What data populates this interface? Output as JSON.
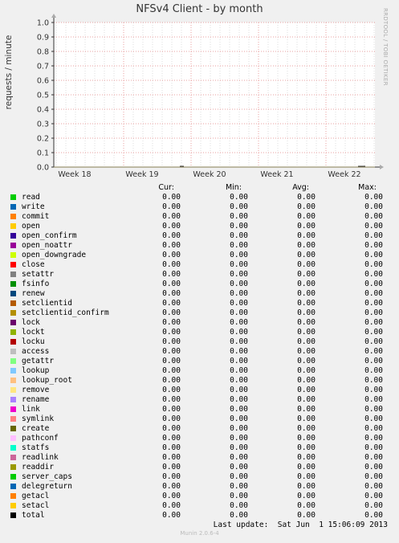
{
  "title": "NFSv4 Client - by month",
  "ylabel": "requests / minute",
  "watermark": "RRDTOOL / TOBI OETIKER",
  "colors": {
    "background": "#f0f0f0",
    "plot_bg": "#ffffff",
    "major_grid": "#e8a0a0",
    "minor_grid": "#dedede",
    "axis": "#333333"
  },
  "legend_headers": {
    "cur": "Cur:",
    "min": "Min:",
    "avg": "Avg:",
    "max": "Max:"
  },
  "chart_data": {
    "type": "line",
    "title": "NFSv4 Client - by month",
    "ylabel": "requests / minute",
    "xlabel": "",
    "ylim": [
      0,
      1.0
    ],
    "yticks": [
      "0.0",
      "0.1",
      "0.2",
      "0.3",
      "0.4",
      "0.5",
      "0.6",
      "0.7",
      "0.8",
      "0.9",
      "1.0"
    ],
    "x_ticks": [
      "Week 18",
      "Week 19",
      "Week 20",
      "Week 21",
      "Week 22"
    ],
    "grid": true,
    "legend_position": "bottom",
    "series": [
      {
        "name": "read",
        "color": "#00cc00",
        "cur": "0.00",
        "min": "0.00",
        "avg": "0.00",
        "max": "0.00"
      },
      {
        "name": "write",
        "color": "#0066b3",
        "cur": "0.00",
        "min": "0.00",
        "avg": "0.00",
        "max": "0.00"
      },
      {
        "name": "commit",
        "color": "#ff8000",
        "cur": "0.00",
        "min": "0.00",
        "avg": "0.00",
        "max": "0.00"
      },
      {
        "name": "open",
        "color": "#ffcc00",
        "cur": "0.00",
        "min": "0.00",
        "avg": "0.00",
        "max": "0.00"
      },
      {
        "name": "open_confirm",
        "color": "#330099",
        "cur": "0.00",
        "min": "0.00",
        "avg": "0.00",
        "max": "0.00"
      },
      {
        "name": "open_noattr",
        "color": "#990099",
        "cur": "0.00",
        "min": "0.00",
        "avg": "0.00",
        "max": "0.00"
      },
      {
        "name": "open_downgrade",
        "color": "#ccff00",
        "cur": "0.00",
        "min": "0.00",
        "avg": "0.00",
        "max": "0.00"
      },
      {
        "name": "close",
        "color": "#ff0000",
        "cur": "0.00",
        "min": "0.00",
        "avg": "0.00",
        "max": "0.00"
      },
      {
        "name": "setattr",
        "color": "#808080",
        "cur": "0.00",
        "min": "0.00",
        "avg": "0.00",
        "max": "0.00"
      },
      {
        "name": "fsinfo",
        "color": "#008f00",
        "cur": "0.00",
        "min": "0.00",
        "avg": "0.00",
        "max": "0.00"
      },
      {
        "name": "renew",
        "color": "#00487d",
        "cur": "0.00",
        "min": "0.00",
        "avg": "0.00",
        "max": "0.00"
      },
      {
        "name": "setclientid",
        "color": "#b35a00",
        "cur": "0.00",
        "min": "0.00",
        "avg": "0.00",
        "max": "0.00"
      },
      {
        "name": "setclientid_confirm",
        "color": "#b38f00",
        "cur": "0.00",
        "min": "0.00",
        "avg": "0.00",
        "max": "0.00"
      },
      {
        "name": "lock",
        "color": "#6b006b",
        "cur": "0.00",
        "min": "0.00",
        "avg": "0.00",
        "max": "0.00"
      },
      {
        "name": "lockt",
        "color": "#8fb300",
        "cur": "0.00",
        "min": "0.00",
        "avg": "0.00",
        "max": "0.00"
      },
      {
        "name": "locku",
        "color": "#b30000",
        "cur": "0.00",
        "min": "0.00",
        "avg": "0.00",
        "max": "0.00"
      },
      {
        "name": "access",
        "color": "#bebebe",
        "cur": "0.00",
        "min": "0.00",
        "avg": "0.00",
        "max": "0.00"
      },
      {
        "name": "getattr",
        "color": "#80ff80",
        "cur": "0.00",
        "min": "0.00",
        "avg": "0.00",
        "max": "0.00"
      },
      {
        "name": "lookup",
        "color": "#80c9ff",
        "cur": "0.00",
        "min": "0.00",
        "avg": "0.00",
        "max": "0.00"
      },
      {
        "name": "lookup_root",
        "color": "#ffc080",
        "cur": "0.00",
        "min": "0.00",
        "avg": "0.00",
        "max": "0.00"
      },
      {
        "name": "remove",
        "color": "#ffe680",
        "cur": "0.00",
        "min": "0.00",
        "avg": "0.00",
        "max": "0.00"
      },
      {
        "name": "rename",
        "color": "#aa80ff",
        "cur": "0.00",
        "min": "0.00",
        "avg": "0.00",
        "max": "0.00"
      },
      {
        "name": "link",
        "color": "#ee00cc",
        "cur": "0.00",
        "min": "0.00",
        "avg": "0.00",
        "max": "0.00"
      },
      {
        "name": "symlink",
        "color": "#ff8080",
        "cur": "0.00",
        "min": "0.00",
        "avg": "0.00",
        "max": "0.00"
      },
      {
        "name": "create",
        "color": "#666600",
        "cur": "0.00",
        "min": "0.00",
        "avg": "0.00",
        "max": "0.00"
      },
      {
        "name": "pathconf",
        "color": "#ffbfff",
        "cur": "0.00",
        "min": "0.00",
        "avg": "0.00",
        "max": "0.00"
      },
      {
        "name": "statfs",
        "color": "#00ffcc",
        "cur": "0.00",
        "min": "0.00",
        "avg": "0.00",
        "max": "0.00"
      },
      {
        "name": "readlink",
        "color": "#cc6699",
        "cur": "0.00",
        "min": "0.00",
        "avg": "0.00",
        "max": "0.00"
      },
      {
        "name": "readdir",
        "color": "#999900",
        "cur": "0.00",
        "min": "0.00",
        "avg": "0.00",
        "max": "0.00"
      },
      {
        "name": "server_caps",
        "color": "#00cc00",
        "cur": "0.00",
        "min": "0.00",
        "avg": "0.00",
        "max": "0.00"
      },
      {
        "name": "delegreturn",
        "color": "#0066b3",
        "cur": "0.00",
        "min": "0.00",
        "avg": "0.00",
        "max": "0.00"
      },
      {
        "name": "getacl",
        "color": "#ff8000",
        "cur": "0.00",
        "min": "0.00",
        "avg": "0.00",
        "max": "0.00"
      },
      {
        "name": "setacl",
        "color": "#ffcc00",
        "cur": "0.00",
        "min": "0.00",
        "avg": "0.00",
        "max": "0.00"
      },
      {
        "name": "total",
        "color": "#000000",
        "cur": "0.00",
        "min": "0.00",
        "avg": "0.00",
        "max": "0.00"
      }
    ]
  },
  "last_update": "Last update:  Sat Jun  1 15:06:09 2013",
  "munin_version": "Munin 2.0.6-4"
}
